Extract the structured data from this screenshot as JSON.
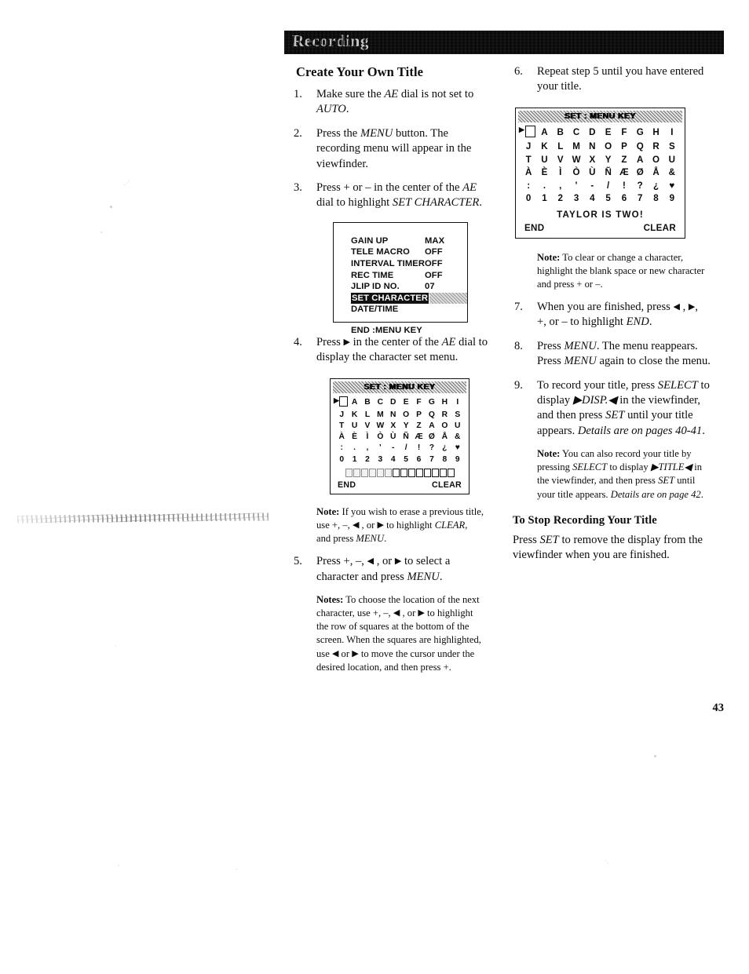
{
  "header": {
    "running_head": "Recording"
  },
  "page": {
    "number": "43"
  },
  "left_column": {
    "section_heading": "Create Your Own Title",
    "step1": {
      "num": "1.",
      "line1_a": "Make sure the ",
      "line1_em": "AE",
      "line1_b": " dial is not set to",
      "line2_em": "AUTO",
      "line2_b": "."
    },
    "step2": {
      "num": "2.",
      "line1_a": "Press the ",
      "line1_em": "MENU",
      "line1_b": " button.  The",
      "line2": "recording menu will appear in the",
      "line3": "viewfinder."
    },
    "step3": {
      "num": "3.",
      "line1_a": "Press  + or –  in the center of the ",
      "line1_em": "AE",
      "line2_a": "dial to highlight ",
      "line2_em": "SET CHARACTER",
      "line2_b": "."
    },
    "menu_osd": {
      "rows": [
        {
          "label": "GAIN UP",
          "value": "MAX",
          "highlighted": false
        },
        {
          "label": "TELE MACRO",
          "value": "OFF",
          "highlighted": false
        },
        {
          "label": "INTERVAL TIMER",
          "value": "OFF",
          "highlighted": false
        },
        {
          "label": "REC TIME",
          "value": "OFF",
          "highlighted": false
        },
        {
          "label": "JLIP ID NO.",
          "value": "07",
          "highlighted": false
        },
        {
          "label": "SET CHARACTER",
          "value": "",
          "highlighted": true
        },
        {
          "label": "DATE/TIME",
          "value": "",
          "highlighted": false
        }
      ],
      "footer": "END :MENU KEY"
    },
    "step4": {
      "num": "4.",
      "line1_a": "Press ",
      "line1_arrow": "▶",
      "line1_b": " in the center of the ",
      "line1_em": "AE",
      "line1_c": " dial to",
      "line2": "display the character set menu."
    },
    "char_osd": {
      "title": "SET : MENU KEY",
      "grid": [
        [
          "",
          "A",
          "B",
          "C",
          "D",
          "E",
          "F",
          "G",
          "H",
          "I"
        ],
        [
          "J",
          "K",
          "L",
          "M",
          "N",
          "O",
          "P",
          "Q",
          "R",
          "S"
        ],
        [
          "T",
          "U",
          "V",
          "W",
          "X",
          "Y",
          "Z",
          "A",
          "O",
          "U"
        ],
        [
          "À",
          "È",
          "Ì",
          "Ò",
          "Ù",
          "Ñ",
          "Æ",
          "Ø",
          "Å",
          "&"
        ],
        [
          ":",
          ".",
          ",",
          "'",
          "-",
          "/",
          "!",
          "?",
          "¿",
          "♥"
        ],
        [
          "0",
          "1",
          "2",
          "3",
          "4",
          "5",
          "6",
          "7",
          "8",
          "9"
        ]
      ],
      "cursor": "▶",
      "slot_count": 14,
      "end_label": "END",
      "clear_label": "CLEAR"
    },
    "note_clear": {
      "label": "Note:",
      "text_a": " If you wish to erase a previous title,",
      "line2_a": "use +, –, ",
      "line2_arrow_l": "◀",
      "line2_b": " , or ",
      "line2_arrow_r": "▶",
      "line2_c": " to highlight ",
      "line2_em": "CLEAR",
      "line2_d": ",",
      "line3_a": "and press ",
      "line3_em": "MENU",
      "line3_b": "."
    },
    "step5": {
      "num": "5.",
      "line1_a": "Press  +, –, ",
      "line1_arrow_l": "◀",
      "line1_b": " , or ",
      "line1_arrow_r": "▶",
      "line1_c": " to select a",
      "line2_a": "character and press ",
      "line2_em": "MENU",
      "line2_b": "."
    },
    "notes_location": {
      "label": "Notes:",
      "line1": "  To choose the location of the next",
      "line2_a": "character, use  +, –, ",
      "line2_arrow_l": "◀",
      "line2_b": " , or ",
      "line2_arrow_r": "▶",
      "line2_c": " to highlight",
      "line3": "the row of squares at the bottom of the",
      "line4": "screen.  When the squares are highlighted,",
      "line5_a": "use ",
      "line5_arrow_l": "◀",
      "line5_b": " or ",
      "line5_arrow_r": "▶",
      "line5_c": " to move the cursor under the",
      "line6": "desired location, and then press +."
    }
  },
  "right_column": {
    "step6": {
      "num": "6.",
      "line1": "Repeat step 5 until you have entered",
      "line2": "your title."
    },
    "char_osd": {
      "title": "SET : MENU KEY",
      "grid": [
        [
          "",
          "A",
          "B",
          "C",
          "D",
          "E",
          "F",
          "G",
          "H",
          "I"
        ],
        [
          "J",
          "K",
          "L",
          "M",
          "N",
          "O",
          "P",
          "Q",
          "R",
          "S"
        ],
        [
          "T",
          "U",
          "V",
          "W",
          "X",
          "Y",
          "Z",
          "A",
          "O",
          "U"
        ],
        [
          "À",
          "È",
          "Ì",
          "Ò",
          "Ù",
          "Ñ",
          "Æ",
          "Ø",
          "Å",
          "&"
        ],
        [
          ":",
          ".",
          ",",
          "'",
          "-",
          "/",
          "!",
          "?",
          "¿",
          "♥"
        ],
        [
          "0",
          "1",
          "2",
          "3",
          "4",
          "5",
          "6",
          "7",
          "8",
          "9"
        ]
      ],
      "cursor": "▶",
      "entered_title": "TAYLOR IS TWO!",
      "end_label": "END",
      "clear_label": "CLEAR"
    },
    "note_change": {
      "label": "Note:",
      "line1": "  To clear or change a character,",
      "line2": "highlight the blank space or new character",
      "line3": "and press + or –."
    },
    "step7": {
      "num": "7.",
      "line1_a": "When you are finished, press ",
      "line1_arrow_l": "◀",
      "line1_b": " , ",
      "line1_arrow_r": "▶",
      "line1_c": ",",
      "line2_a": "+, or – to highlight ",
      "line2_em": "END",
      "line2_b": "."
    },
    "step8": {
      "num": "8.",
      "line1_a": "Press ",
      "line1_em": "MENU",
      "line1_b": ".  The menu reappears.",
      "line2_a": "Press ",
      "line2_em": "MENU",
      "line2_b": " again to close the menu."
    },
    "step9": {
      "num": "9.",
      "line1_a": "To record your title, press ",
      "line1_em": "SELECT",
      "line1_b": " to",
      "line2_a": "display ",
      "line2_em": "▶DISP.◀",
      "line2_b": " in the viewfinder,",
      "line3_a": "and then press ",
      "line3_em": "SET",
      "line3_b": " until your title",
      "line4_a": "appears.  ",
      "line4_em": "Details are on pages 40-41",
      "line4_b": "."
    },
    "note_title": {
      "label": "Note:",
      "line1": "  You can also record your title by",
      "line2_a": "pressing ",
      "line2_em": "SELECT",
      "line2_b": " to display ",
      "line2_em2": "▶TITLE◀",
      "line2_c": " in",
      "line3_a": "the viewfinder, and then press ",
      "line3_em": "SET",
      "line3_b": " until",
      "line4_a": "your title appears. ",
      "line4_em": "Details are on page 42",
      "line4_b": "."
    },
    "stop_section": {
      "heading": "To Stop Recording Your  Title",
      "line1_a": "Press ",
      "line1_em": "SET",
      "line1_b": " to remove the display from the",
      "line2": "viewfinder when you are finished."
    }
  }
}
